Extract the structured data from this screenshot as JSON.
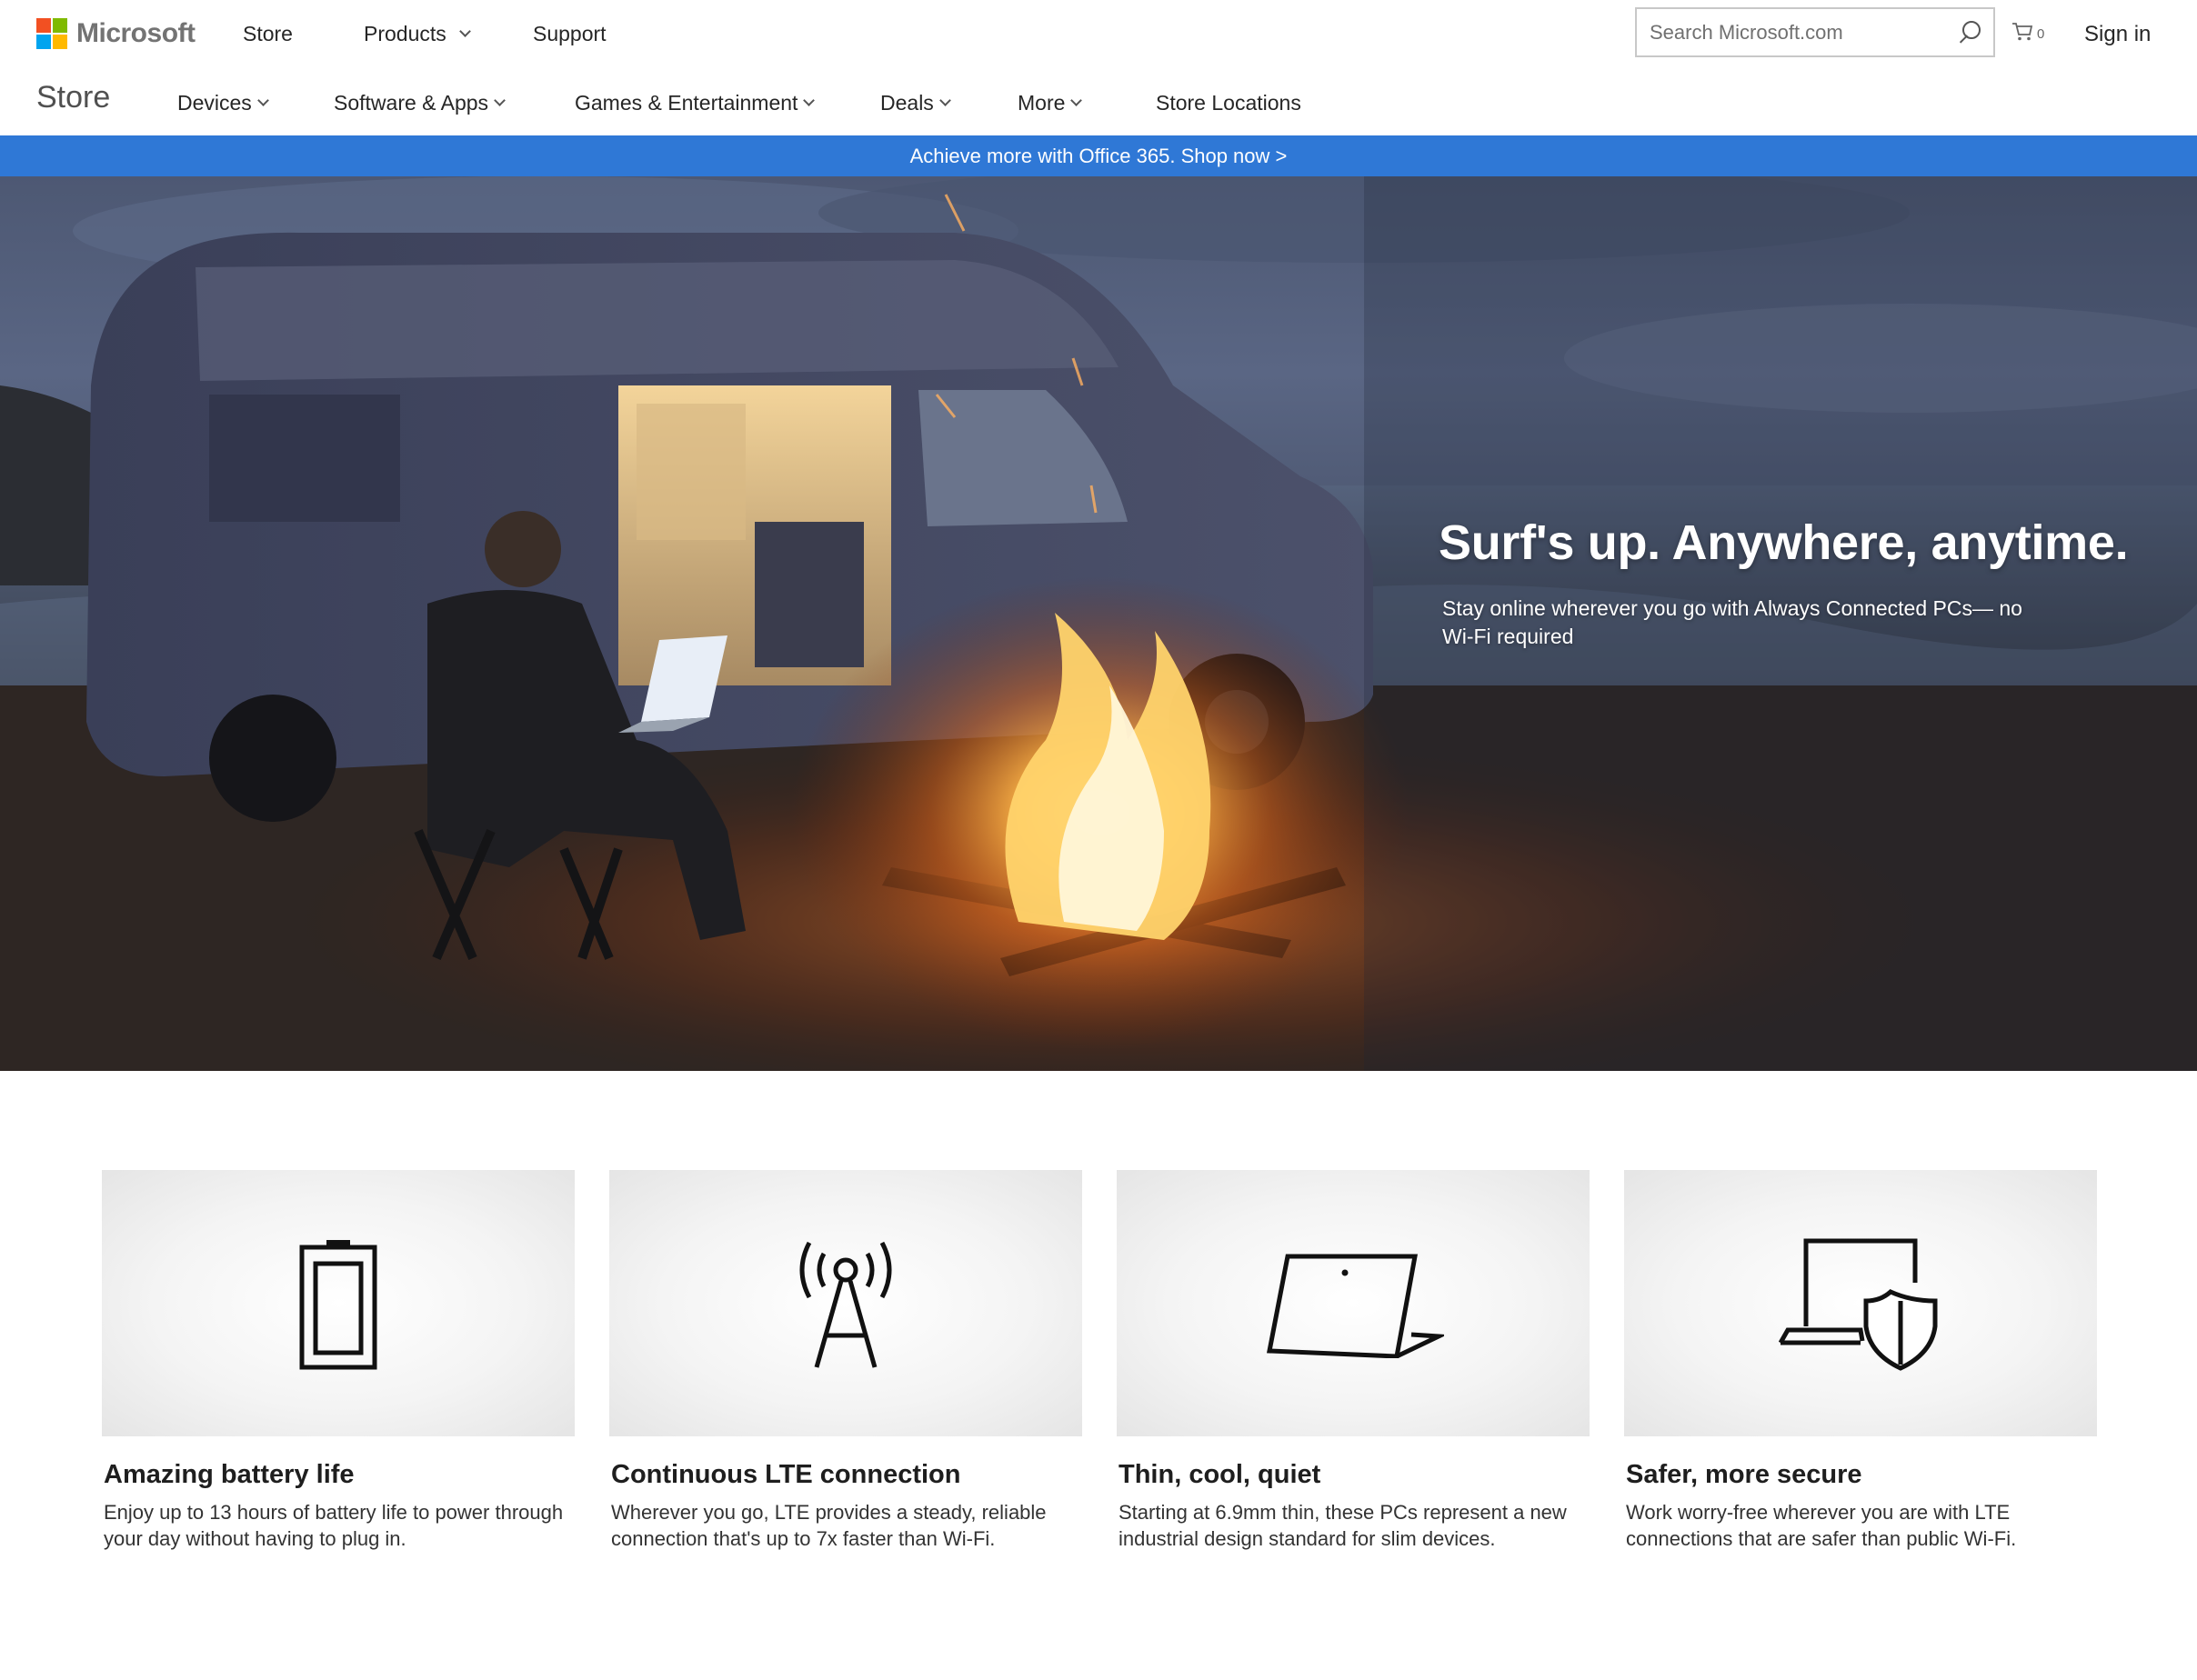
{
  "header": {
    "brand": "Microsoft",
    "nav": [
      {
        "label": "Store",
        "has_dropdown": false
      },
      {
        "label": "Products",
        "has_dropdown": true
      },
      {
        "label": "Support",
        "has_dropdown": false
      }
    ],
    "search_placeholder": "Search Microsoft.com",
    "cart_count": "0",
    "sign_in": "Sign in"
  },
  "store_nav": {
    "title": "Store",
    "items": [
      {
        "label": "Devices",
        "has_dropdown": true
      },
      {
        "label": "Software & Apps",
        "has_dropdown": true
      },
      {
        "label": "Games & Entertainment",
        "has_dropdown": true
      },
      {
        "label": "Deals",
        "has_dropdown": true
      },
      {
        "label": "More",
        "has_dropdown": true
      },
      {
        "label": "Store Locations",
        "has_dropdown": false
      }
    ]
  },
  "promo_banner": "Achieve more with Office 365. Shop now >",
  "hero": {
    "headline": "Surf's up. Anywhere, anytime.",
    "subtext": "Stay online wherever you go with Always Connected PCs— no Wi-Fi required"
  },
  "features": [
    {
      "icon": "battery-icon",
      "title": "Amazing battery life",
      "description": "Enjoy up to 13 hours of battery life to power through your day without having to plug in."
    },
    {
      "icon": "lte-tower-icon",
      "title": "Continuous LTE connection",
      "description": "Wherever you go, LTE provides a steady, reliable connection that's up to 7x faster than Wi-Fi."
    },
    {
      "icon": "laptop-icon",
      "title": "Thin, cool, quiet",
      "description": "Starting at 6.9mm thin, these PCs represent a new industrial design standard for slim devices."
    },
    {
      "icon": "laptop-shield-icon",
      "title": "Safer, more secure",
      "description": "Work worry-free wherever you are with LTE connections that are safer than public Wi-Fi."
    }
  ],
  "colors": {
    "promo_blue": "#2f78d6",
    "logo_red": "#f25022",
    "logo_green": "#7fba00",
    "logo_blue": "#00a4ef",
    "logo_yellow": "#ffb900"
  }
}
